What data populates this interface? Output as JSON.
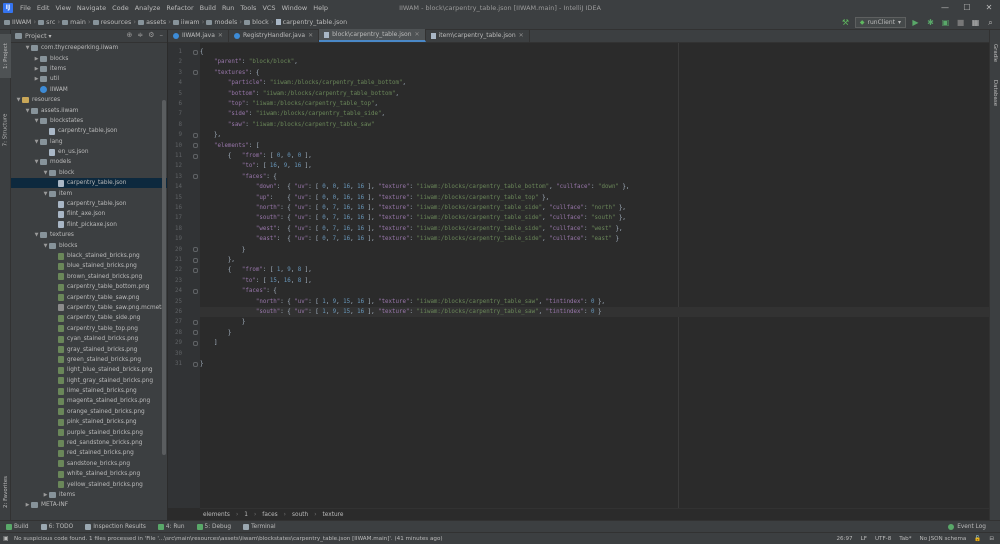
{
  "menu": {
    "items": [
      "File",
      "Edit",
      "View",
      "Navigate",
      "Code",
      "Analyze",
      "Refactor",
      "Build",
      "Run",
      "Tools",
      "VCS",
      "Window",
      "Help"
    ],
    "title": "IIWAM - block\\carpentry_table.json [IIWAM.main] - IntelliJ IDEA"
  },
  "navbar": {
    "crumbs": [
      "IIWAM",
      "src",
      "main",
      "resources",
      "assets",
      "iiwam",
      "models",
      "block",
      "carpentry_table.json"
    ],
    "run_config": "runClient"
  },
  "left_strip": {
    "project_tab": "1: Project",
    "structure_tab": "7: Structure",
    "favorites_tab": "2: Favorites"
  },
  "right_strip": {
    "gradle_tab": "Gradle",
    "database_tab": "Database"
  },
  "project_panel": {
    "title": "Project",
    "tree": [
      {
        "label": "com.thycreeperking.iiwam",
        "icon": "package-icon",
        "depth": 1,
        "expanded": true
      },
      {
        "label": "blocks",
        "icon": "package-icon",
        "depth": 2,
        "expanded": false
      },
      {
        "label": "items",
        "icon": "package-icon",
        "depth": 2,
        "expanded": false
      },
      {
        "label": "util",
        "icon": "package-icon",
        "depth": 2,
        "expanded": false
      },
      {
        "label": "IIWAM",
        "icon": "java-class-icon",
        "depth": 2,
        "leaf": true
      },
      {
        "label": "resources",
        "icon": "resources-folder-icon",
        "depth": 0,
        "expanded": true
      },
      {
        "label": "assets.iiwam",
        "icon": "folder-icon",
        "depth": 1,
        "expanded": true
      },
      {
        "label": "blockstates",
        "icon": "folder-icon",
        "depth": 2,
        "expanded": true
      },
      {
        "label": "carpentry_table.json",
        "icon": "json-file-icon",
        "depth": 3,
        "leaf": true
      },
      {
        "label": "lang",
        "icon": "folder-icon",
        "depth": 2,
        "expanded": true
      },
      {
        "label": "en_us.json",
        "icon": "json-file-icon",
        "depth": 3,
        "leaf": true
      },
      {
        "label": "models",
        "icon": "folder-icon",
        "depth": 2,
        "expanded": true
      },
      {
        "label": "block",
        "icon": "folder-icon",
        "depth": 3,
        "expanded": true
      },
      {
        "label": "carpentry_table.json",
        "icon": "json-file-icon",
        "depth": 4,
        "leaf": true,
        "selected": true
      },
      {
        "label": "item",
        "icon": "folder-icon",
        "depth": 3,
        "expanded": true
      },
      {
        "label": "carpentry_table.json",
        "icon": "json-file-icon",
        "depth": 4,
        "leaf": true
      },
      {
        "label": "flint_axe.json",
        "icon": "json-file-icon",
        "depth": 4,
        "leaf": true
      },
      {
        "label": "flint_pickaxe.json",
        "icon": "json-file-icon",
        "depth": 4,
        "leaf": true
      },
      {
        "label": "textures",
        "icon": "folder-icon",
        "depth": 2,
        "expanded": true
      },
      {
        "label": "blocks",
        "icon": "folder-icon",
        "depth": 3,
        "expanded": true
      },
      {
        "label": "black_stained_bricks.png",
        "icon": "png-file-icon",
        "depth": 4,
        "leaf": true
      },
      {
        "label": "blue_stained_bricks.png",
        "icon": "png-file-icon",
        "depth": 4,
        "leaf": true
      },
      {
        "label": "brown_stained_bricks.png",
        "icon": "png-file-icon",
        "depth": 4,
        "leaf": true
      },
      {
        "label": "carpentry_table_bottom.png",
        "icon": "png-file-icon",
        "depth": 4,
        "leaf": true
      },
      {
        "label": "carpentry_table_saw.png",
        "icon": "png-file-icon",
        "depth": 4,
        "leaf": true
      },
      {
        "label": "carpentry_table_saw.png.mcmeta",
        "icon": "unknown-file-icon",
        "depth": 4,
        "leaf": true
      },
      {
        "label": "carpentry_table_side.png",
        "icon": "png-file-icon",
        "depth": 4,
        "leaf": true
      },
      {
        "label": "carpentry_table_top.png",
        "icon": "png-file-icon",
        "depth": 4,
        "leaf": true
      },
      {
        "label": "cyan_stained_bricks.png",
        "icon": "png-file-icon",
        "depth": 4,
        "leaf": true
      },
      {
        "label": "gray_stained_bricks.png",
        "icon": "png-file-icon",
        "depth": 4,
        "leaf": true
      },
      {
        "label": "green_stained_bricks.png",
        "icon": "png-file-icon",
        "depth": 4,
        "leaf": true
      },
      {
        "label": "light_blue_stained_bricks.png",
        "icon": "png-file-icon",
        "depth": 4,
        "leaf": true
      },
      {
        "label": "light_gray_stained_bricks.png",
        "icon": "png-file-icon",
        "depth": 4,
        "leaf": true
      },
      {
        "label": "lime_stained_bricks.png",
        "icon": "png-file-icon",
        "depth": 4,
        "leaf": true
      },
      {
        "label": "magenta_stained_bricks.png",
        "icon": "png-file-icon",
        "depth": 4,
        "leaf": true
      },
      {
        "label": "orange_stained_bricks.png",
        "icon": "png-file-icon",
        "depth": 4,
        "leaf": true
      },
      {
        "label": "pink_stained_bricks.png",
        "icon": "png-file-icon",
        "depth": 4,
        "leaf": true
      },
      {
        "label": "purple_stained_bricks.png",
        "icon": "png-file-icon",
        "depth": 4,
        "leaf": true
      },
      {
        "label": "red_sandstone_bricks.png",
        "icon": "png-file-icon",
        "depth": 4,
        "leaf": true
      },
      {
        "label": "red_stained_bricks.png",
        "icon": "png-file-icon",
        "depth": 4,
        "leaf": true
      },
      {
        "label": "sandstone_bricks.png",
        "icon": "png-file-icon",
        "depth": 4,
        "leaf": true
      },
      {
        "label": "white_stained_bricks.png",
        "icon": "png-file-icon",
        "depth": 4,
        "leaf": true
      },
      {
        "label": "yellow_stained_bricks.png",
        "icon": "png-file-icon",
        "depth": 4,
        "leaf": true
      },
      {
        "label": "items",
        "icon": "folder-icon",
        "depth": 3,
        "expanded": false
      },
      {
        "label": "META-INF",
        "icon": "folder-icon",
        "depth": 1,
        "expanded": false
      }
    ]
  },
  "editor": {
    "tabs": [
      {
        "label": "IIWAM.java",
        "icon": "java-class-icon",
        "active": false
      },
      {
        "label": "RegistryHandler.java",
        "icon": "java-class-icon",
        "active": false
      },
      {
        "label": "block\\carpentry_table.json",
        "icon": "json-file-icon",
        "active": true
      },
      {
        "label": "item\\carpentry_table.json",
        "icon": "json-file-icon",
        "active": false
      }
    ],
    "current_line": 26,
    "lines": [
      "{",
      "    \"parent\": \"block/block\",",
      "    \"textures\": {",
      "        \"particle\": \"iiwam:/blocks/carpentry_table_bottom\",",
      "        \"bottom\": \"iiwam:/blocks/carpentry_table_bottom\",",
      "        \"top\": \"iiwam:/blocks/carpentry_table_top\",",
      "        \"side\": \"iiwam:/blocks/carpentry_table_side\",",
      "        \"saw\": \"iiwam:/blocks/carpentry_table_saw\"",
      "    },",
      "    \"elements\": [",
      "        {   \"from\": [ 0, 0, 0 ],",
      "            \"to\": [ 16, 9, 16 ],",
      "            \"faces\": {",
      "                \"down\":  { \"uv\": [ 0, 0, 16, 16 ], \"texture\": \"iiwam:/blocks/carpentry_table_bottom\", \"cullface\": \"down\" },",
      "                \"up\":    { \"uv\": [ 0, 0, 16, 16 ], \"texture\": \"iiwam:/blocks/carpentry_table_top\" },",
      "                \"north\": { \"uv\": [ 0, 7, 16, 16 ], \"texture\": \"iiwam:/blocks/carpentry_table_side\", \"cullface\": \"north\" },",
      "                \"south\": { \"uv\": [ 0, 7, 16, 16 ], \"texture\": \"iiwam:/blocks/carpentry_table_side\", \"cullface\": \"south\" },",
      "                \"west\":  { \"uv\": [ 0, 7, 16, 16 ], \"texture\": \"iiwam:/blocks/carpentry_table_side\", \"cullface\": \"west\" },",
      "                \"east\":  { \"uv\": [ 0, 7, 16, 16 ], \"texture\": \"iiwam:/blocks/carpentry_table_side\", \"cullface\": \"east\" }",
      "            }",
      "        },",
      "        {   \"from\": [ 1, 9, 8 ],",
      "            \"to\": [ 15, 16, 8 ],",
      "            \"faces\": {",
      "                \"north\": { \"uv\": [ 1, 9, 15, 16 ], \"texture\": \"iiwam:/blocks/carpentry_table_saw\", \"tintindex\": 0 },",
      "                \"south\": { \"uv\": [ 1, 9, 15, 16 ], \"texture\": \"iiwam:/blocks/carpentry_table_saw\", \"tintindex\": 0 }",
      "            }",
      "        }",
      "    ]",
      "",
      "}"
    ],
    "crumbs": [
      "elements",
      "1",
      "faces",
      "south",
      "texture"
    ]
  },
  "tool_windows": [
    {
      "label": "Build",
      "icon": "build-icon"
    },
    {
      "label": "6: TODO",
      "icon": "todo-icon"
    },
    {
      "label": "Inspection Results",
      "icon": "inspection-icon"
    },
    {
      "label": "4: Run",
      "icon": "run-icon"
    },
    {
      "label": "5: Debug",
      "icon": "debug-icon"
    },
    {
      "label": "Terminal",
      "icon": "terminal-icon"
    }
  ],
  "event_log": "Event Log",
  "status": {
    "message": "No suspicious code found. 1 files processed in 'File '...\\src\\main\\resources\\assets\\iiwam\\blockstates\\carpentry_table.json [IIWAM.main]'. (41 minutes ago)",
    "position": "26:97",
    "line_sep": "LF",
    "encoding": "UTF-8",
    "indent": "Tab*",
    "schema": "No JSON schema"
  },
  "colors": {
    "key": "#9876aa",
    "string": "#6a8759",
    "number": "#6897bb",
    "plain": "#a9b7c6",
    "selection": "#0d293e",
    "accent": "#4a88c7"
  }
}
